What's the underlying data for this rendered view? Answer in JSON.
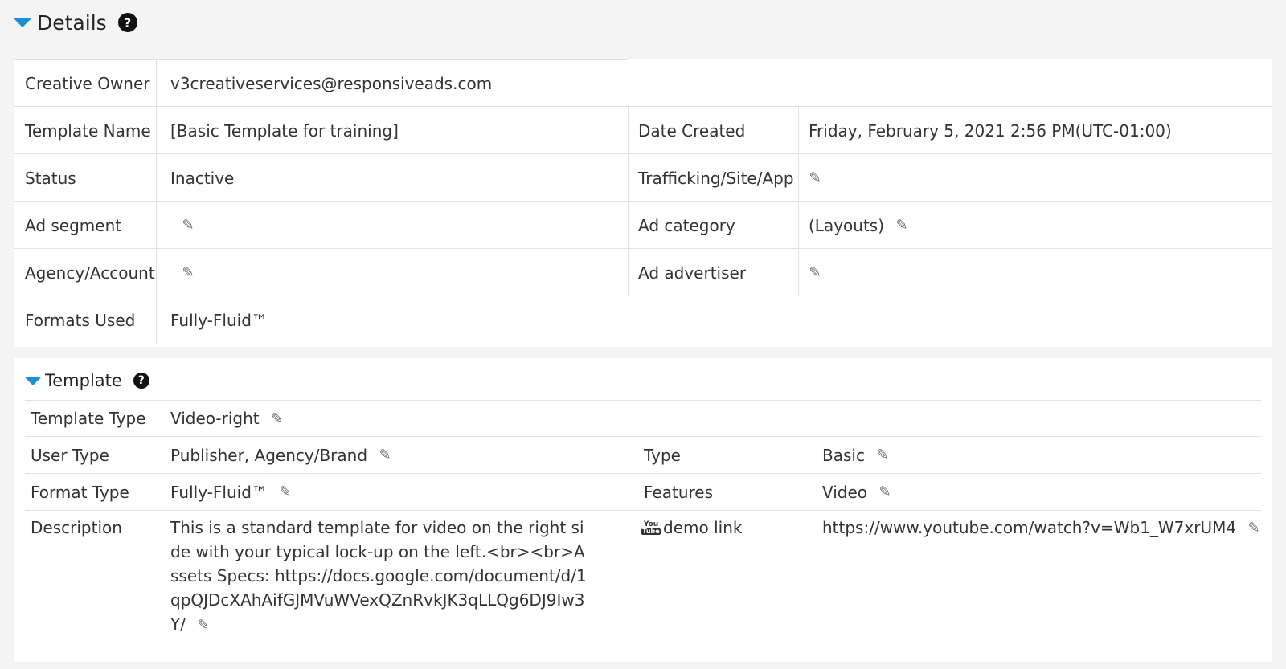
{
  "details": {
    "title": "Details",
    "help_icon": "?",
    "rows": {
      "creative_owner": {
        "label": "Creative Owner",
        "value": "v3creativeservices@responsiveads.com"
      },
      "template_name": {
        "label": "Template Name",
        "value": "[Basic Template for training]"
      },
      "date_created": {
        "label": "Date Created",
        "value": "Friday, February 5, 2021 2:56 PM(UTC-01:00)"
      },
      "status": {
        "label": "Status",
        "value": "Inactive"
      },
      "trafficking": {
        "label": "Trafficking/Site/App",
        "value": ""
      },
      "ad_segment": {
        "label": "Ad segment",
        "value": ""
      },
      "ad_category": {
        "label": "Ad category",
        "value": "(Layouts)"
      },
      "agency_account": {
        "label": "Agency/Account",
        "value": ""
      },
      "ad_advertiser": {
        "label": "Ad advertiser",
        "value": ""
      },
      "formats_used": {
        "label": "Formats Used",
        "value": "Fully-Fluid™"
      }
    }
  },
  "template": {
    "title": "Template",
    "help_icon": "?",
    "template_type": {
      "label": "Template Type",
      "value": "Video-right"
    },
    "user_type": {
      "label": "User Type",
      "value": "Publisher, Agency/Brand"
    },
    "type": {
      "label": "Type",
      "value": "Basic"
    },
    "format_type": {
      "label": "Format Type",
      "value": "Fully-Fluid™"
    },
    "features": {
      "label": "Features",
      "value": "Video"
    },
    "description": {
      "label": "Description",
      "value": "This is a standard template for video on the right side with your typical lock-up on the left.<br><br>Assets Specs: https://docs.google.com/document/d/1qpQJDcXAhAifGJMVuWVexQZnRvkJK3qLLQg6DJ9Iw3Y/"
    },
    "demo_link": {
      "label": "demo link",
      "value": "https://www.youtube.com/watch?v=Wb1_W7xrUM4",
      "icon_you": "You",
      "icon_tube": "Tube"
    }
  },
  "icons": {
    "pencil": "✎",
    "caret": "caret-down-icon"
  },
  "colors": {
    "accent": "#1a8fd6",
    "background": "#f4f4f4",
    "card": "#ffffff",
    "divider": "#e2e2e2"
  }
}
